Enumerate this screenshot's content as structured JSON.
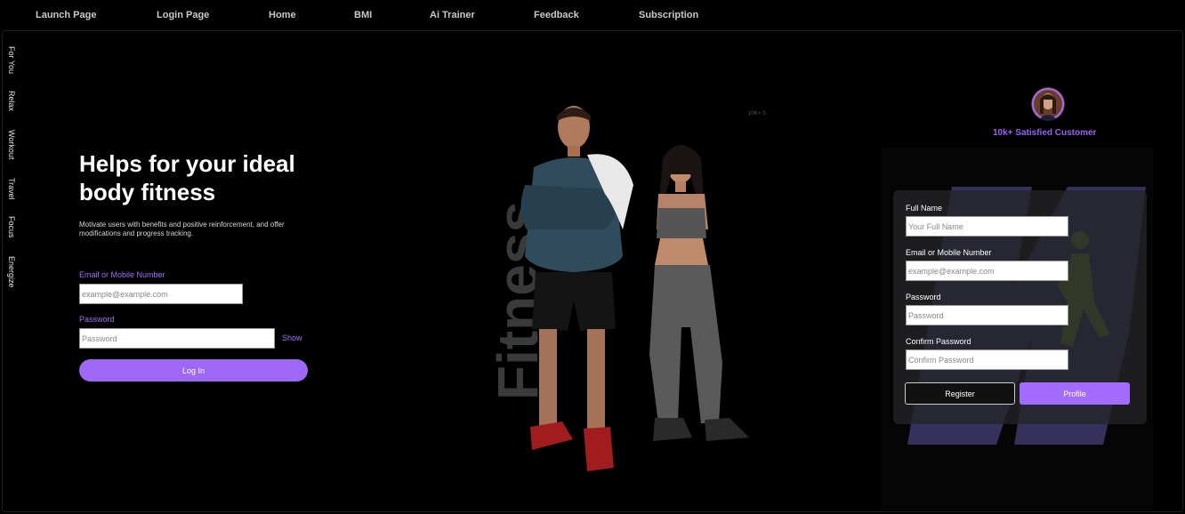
{
  "nav": {
    "items": [
      {
        "label": "Launch Page"
      },
      {
        "label": "Login Page"
      },
      {
        "label": "Home"
      },
      {
        "label": "BMI"
      },
      {
        "label": "Ai Trainer"
      },
      {
        "label": "Feedback"
      },
      {
        "label": "Subscription"
      }
    ]
  },
  "sidebar": {
    "items": [
      {
        "label": "For You"
      },
      {
        "label": "Relax"
      },
      {
        "label": "Workout"
      },
      {
        "label": "Travel"
      },
      {
        "label": "Focus"
      },
      {
        "label": "Energize"
      }
    ]
  },
  "hero": {
    "title": "Helps for your ideal body fitness",
    "description": "Motivate users with benefits and positive reinforcement, and offer modifications and progress tracking.",
    "watermark": "Fitness",
    "badge": "10K+ S"
  },
  "login": {
    "email_label": "Email or Mobile Number",
    "email_placeholder": "example@example.com",
    "password_label": "Password",
    "password_placeholder": "Password",
    "show_label": "Show",
    "button_label": "Log In"
  },
  "customers": {
    "text": "10k+ Satisfied Customer"
  },
  "register": {
    "fullname_label": "Full Name",
    "fullname_placeholder": "Your Full Name",
    "email_label": "Email or Mobile Number",
    "email_placeholder": "example@example.com",
    "password_label": "Password",
    "password_placeholder": "Password",
    "confirm_label": "Confirm Password",
    "confirm_placeholder": "Confirm Password",
    "register_button": "Register",
    "profile_button": "Profile"
  },
  "colors": {
    "accent": "#a46bff",
    "background": "#000000",
    "card": "#242428",
    "logo": "#3b3566"
  }
}
